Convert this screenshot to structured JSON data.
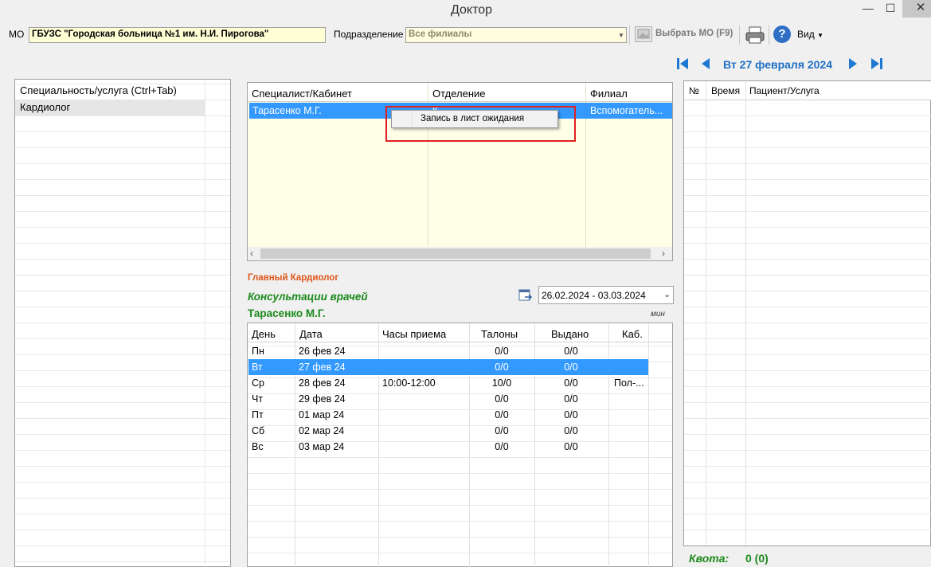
{
  "window": {
    "title": "Доктор",
    "minimize": "—",
    "maximize": "☐",
    "close": "✕"
  },
  "toolbar": {
    "mo_label": "МО",
    "mo_value": "ГБУЗС \"Городская больница №1 им. Н.И. Пирогова\"",
    "sub_label": "Подразделение",
    "sub_value": "Все филиалы",
    "select_mo": "Выбрать МО (F9)",
    "view": "Вид"
  },
  "datenav": {
    "date": "Вт 27 февраля 2024"
  },
  "left": {
    "header": "Специальность/услуга (Ctrl+Tab)",
    "items": [
      "Кардиолог"
    ]
  },
  "specialists": {
    "columns": [
      "Специалист/Кабинет",
      "Отделение",
      "Филиал"
    ],
    "rows": [
      {
        "name": "Тарасенко М.Г.",
        "dept": "К",
        "branch": "Вспомогатель..."
      }
    ]
  },
  "context_menu": {
    "item": "Запись в лист ожидания"
  },
  "info": {
    "role": "Главный Кардиолог",
    "consult": "Консультации врачей",
    "doctor": "Тарасенко М.Г.",
    "min": "мин",
    "period": "26.02.2024 - 03.03.2024"
  },
  "schedule": {
    "columns": [
      "День",
      "Дата",
      "Часы приема",
      "Талоны",
      "Выдано",
      "Каб."
    ],
    "rows": [
      {
        "day": "Пн",
        "date": "26 фев 24",
        "hours": "",
        "tickets": "0/0",
        "issued": "0/0",
        "cab": ""
      },
      {
        "day": "Вт",
        "date": "27 фев 24",
        "hours": "",
        "tickets": "0/0",
        "issued": "0/0",
        "cab": ""
      },
      {
        "day": "Ср",
        "date": "28 фев 24",
        "hours": "10:00-12:00",
        "tickets": "10/0",
        "issued": "0/0",
        "cab": "Пол-..."
      },
      {
        "day": "Чт",
        "date": "29 фев 24",
        "hours": "",
        "tickets": "0/0",
        "issued": "0/0",
        "cab": ""
      },
      {
        "day": "Пт",
        "date": "01 мар 24",
        "hours": "",
        "tickets": "0/0",
        "issued": "0/0",
        "cab": ""
      },
      {
        "day": "Сб",
        "date": "02 мар 24",
        "hours": "",
        "tickets": "0/0",
        "issued": "0/0",
        "cab": ""
      },
      {
        "day": "Вс",
        "date": "03 мар 24",
        "hours": "",
        "tickets": "0/0",
        "issued": "0/0",
        "cab": ""
      }
    ]
  },
  "right": {
    "columns": [
      "№",
      "Время",
      "Пациент/Услуга"
    ]
  },
  "quota": {
    "label": "Квота:",
    "value": "0 (0)"
  }
}
